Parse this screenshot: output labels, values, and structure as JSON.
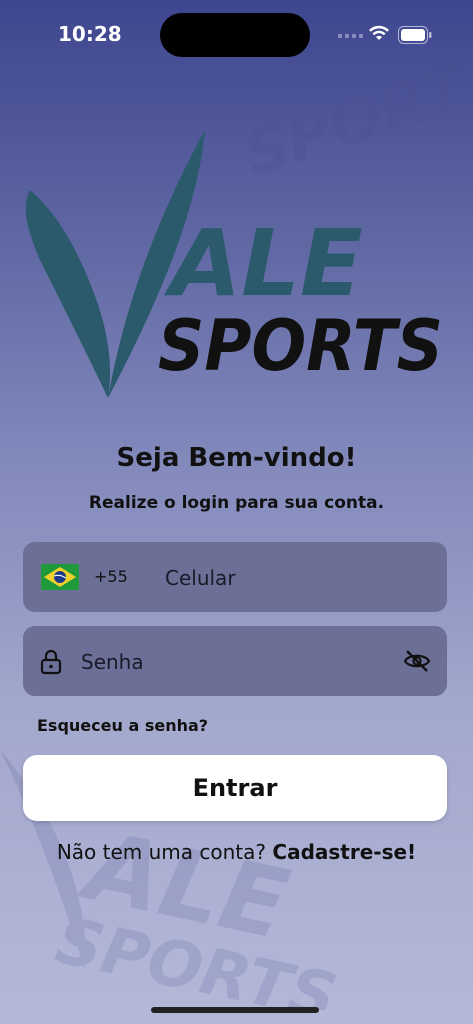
{
  "status_bar": {
    "time": "10:28"
  },
  "brand": {
    "line1": "ALE",
    "line2": "SPORTS",
    "logo_color": "#2a5a6c",
    "wordmark_color": "#111111"
  },
  "header": {
    "title": "Seja Bem-vindo!",
    "subtitle": "Realize o login para sua conta."
  },
  "form": {
    "phone": {
      "country_flag": "brazil-flag-icon",
      "ddi": "+55",
      "placeholder": "Celular"
    },
    "password": {
      "placeholder": "Senha",
      "lock_icon": "lock-icon",
      "toggle_icon": "eye-off-icon"
    },
    "forgot_label": "Esqueceu a senha?",
    "submit_label": "Entrar"
  },
  "footer": {
    "question": "Não tem uma conta?",
    "link": "Cadastre-se!"
  },
  "colors": {
    "field_bg": "#6c6f96",
    "button_bg": "#ffffff",
    "gradient_top": "#3e4690",
    "gradient_bottom": "#b4b8d8"
  }
}
